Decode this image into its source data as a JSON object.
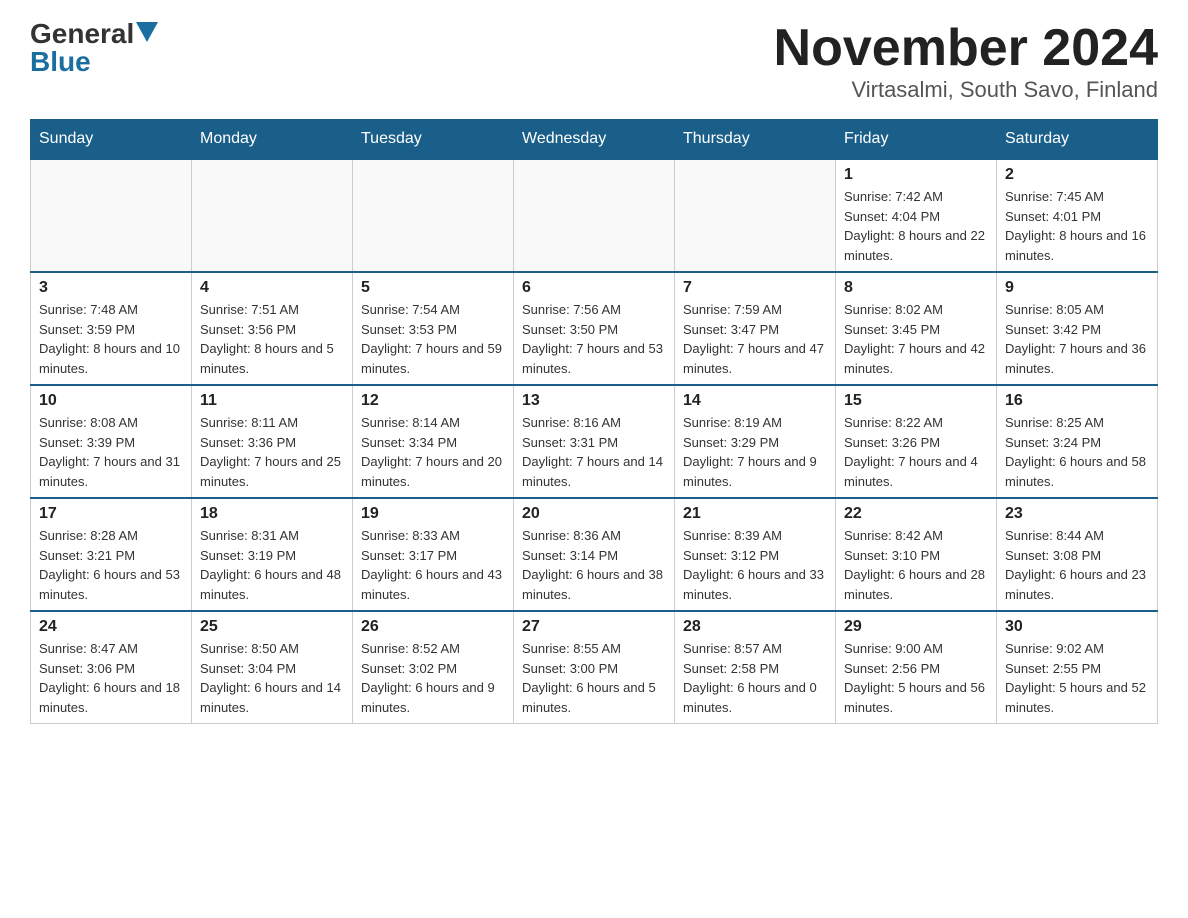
{
  "logo": {
    "part1": "General",
    "part2": "Blue"
  },
  "title": "November 2024",
  "subtitle": "Virtasalmi, South Savo, Finland",
  "days_of_week": [
    "Sunday",
    "Monday",
    "Tuesday",
    "Wednesday",
    "Thursday",
    "Friday",
    "Saturday"
  ],
  "weeks": [
    [
      {
        "day": "",
        "info": ""
      },
      {
        "day": "",
        "info": ""
      },
      {
        "day": "",
        "info": ""
      },
      {
        "day": "",
        "info": ""
      },
      {
        "day": "",
        "info": ""
      },
      {
        "day": "1",
        "info": "Sunrise: 7:42 AM\nSunset: 4:04 PM\nDaylight: 8 hours and 22 minutes."
      },
      {
        "day": "2",
        "info": "Sunrise: 7:45 AM\nSunset: 4:01 PM\nDaylight: 8 hours and 16 minutes."
      }
    ],
    [
      {
        "day": "3",
        "info": "Sunrise: 7:48 AM\nSunset: 3:59 PM\nDaylight: 8 hours and 10 minutes."
      },
      {
        "day": "4",
        "info": "Sunrise: 7:51 AM\nSunset: 3:56 PM\nDaylight: 8 hours and 5 minutes."
      },
      {
        "day": "5",
        "info": "Sunrise: 7:54 AM\nSunset: 3:53 PM\nDaylight: 7 hours and 59 minutes."
      },
      {
        "day": "6",
        "info": "Sunrise: 7:56 AM\nSunset: 3:50 PM\nDaylight: 7 hours and 53 minutes."
      },
      {
        "day": "7",
        "info": "Sunrise: 7:59 AM\nSunset: 3:47 PM\nDaylight: 7 hours and 47 minutes."
      },
      {
        "day": "8",
        "info": "Sunrise: 8:02 AM\nSunset: 3:45 PM\nDaylight: 7 hours and 42 minutes."
      },
      {
        "day": "9",
        "info": "Sunrise: 8:05 AM\nSunset: 3:42 PM\nDaylight: 7 hours and 36 minutes."
      }
    ],
    [
      {
        "day": "10",
        "info": "Sunrise: 8:08 AM\nSunset: 3:39 PM\nDaylight: 7 hours and 31 minutes."
      },
      {
        "day": "11",
        "info": "Sunrise: 8:11 AM\nSunset: 3:36 PM\nDaylight: 7 hours and 25 minutes."
      },
      {
        "day": "12",
        "info": "Sunrise: 8:14 AM\nSunset: 3:34 PM\nDaylight: 7 hours and 20 minutes."
      },
      {
        "day": "13",
        "info": "Sunrise: 8:16 AM\nSunset: 3:31 PM\nDaylight: 7 hours and 14 minutes."
      },
      {
        "day": "14",
        "info": "Sunrise: 8:19 AM\nSunset: 3:29 PM\nDaylight: 7 hours and 9 minutes."
      },
      {
        "day": "15",
        "info": "Sunrise: 8:22 AM\nSunset: 3:26 PM\nDaylight: 7 hours and 4 minutes."
      },
      {
        "day": "16",
        "info": "Sunrise: 8:25 AM\nSunset: 3:24 PM\nDaylight: 6 hours and 58 minutes."
      }
    ],
    [
      {
        "day": "17",
        "info": "Sunrise: 8:28 AM\nSunset: 3:21 PM\nDaylight: 6 hours and 53 minutes."
      },
      {
        "day": "18",
        "info": "Sunrise: 8:31 AM\nSunset: 3:19 PM\nDaylight: 6 hours and 48 minutes."
      },
      {
        "day": "19",
        "info": "Sunrise: 8:33 AM\nSunset: 3:17 PM\nDaylight: 6 hours and 43 minutes."
      },
      {
        "day": "20",
        "info": "Sunrise: 8:36 AM\nSunset: 3:14 PM\nDaylight: 6 hours and 38 minutes."
      },
      {
        "day": "21",
        "info": "Sunrise: 8:39 AM\nSunset: 3:12 PM\nDaylight: 6 hours and 33 minutes."
      },
      {
        "day": "22",
        "info": "Sunrise: 8:42 AM\nSunset: 3:10 PM\nDaylight: 6 hours and 28 minutes."
      },
      {
        "day": "23",
        "info": "Sunrise: 8:44 AM\nSunset: 3:08 PM\nDaylight: 6 hours and 23 minutes."
      }
    ],
    [
      {
        "day": "24",
        "info": "Sunrise: 8:47 AM\nSunset: 3:06 PM\nDaylight: 6 hours and 18 minutes."
      },
      {
        "day": "25",
        "info": "Sunrise: 8:50 AM\nSunset: 3:04 PM\nDaylight: 6 hours and 14 minutes."
      },
      {
        "day": "26",
        "info": "Sunrise: 8:52 AM\nSunset: 3:02 PM\nDaylight: 6 hours and 9 minutes."
      },
      {
        "day": "27",
        "info": "Sunrise: 8:55 AM\nSunset: 3:00 PM\nDaylight: 6 hours and 5 minutes."
      },
      {
        "day": "28",
        "info": "Sunrise: 8:57 AM\nSunset: 2:58 PM\nDaylight: 6 hours and 0 minutes."
      },
      {
        "day": "29",
        "info": "Sunrise: 9:00 AM\nSunset: 2:56 PM\nDaylight: 5 hours and 56 minutes."
      },
      {
        "day": "30",
        "info": "Sunrise: 9:02 AM\nSunset: 2:55 PM\nDaylight: 5 hours and 52 minutes."
      }
    ]
  ]
}
